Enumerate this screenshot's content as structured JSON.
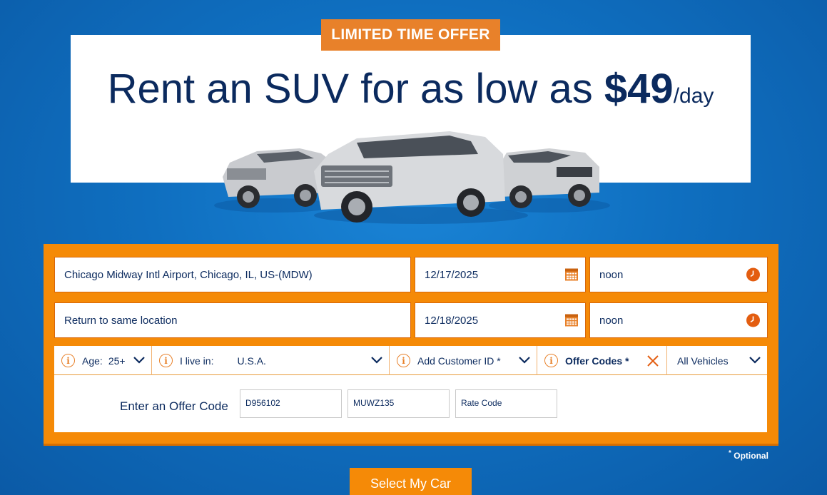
{
  "promo": {
    "badge": "LIMITED TIME OFFER",
    "headline_pre": "Rent an SUV for as low as ",
    "price": "$49",
    "per": "/day"
  },
  "booking": {
    "pickup_location": "Chicago Midway Intl Airport, Chicago, IL, US-(MDW)",
    "pickup_date": "12/17/2025",
    "pickup_time": "noon",
    "return_location": "Return to same location",
    "return_date": "12/18/2025",
    "return_time": "noon"
  },
  "options": {
    "age_label": "Age:",
    "age_value": "25+",
    "live_label": "I live in:",
    "live_value": "U.S.A.",
    "customer_id": "Add Customer ID *",
    "offer_codes": "Offer Codes *",
    "vehicles": "All Vehicles"
  },
  "offer_codes": {
    "label": "Enter an Offer Code",
    "code1": "D956102",
    "code2": "MUWZ135",
    "code3_placeholder": "Rate Code"
  },
  "footer": {
    "optional_mark": "*",
    "optional_text": "Optional",
    "submit": "Select My Car"
  },
  "colors": {
    "accent_orange": "#f58a07",
    "navy_text": "#0b2a5e",
    "background_blue": "#0f6fc0"
  }
}
